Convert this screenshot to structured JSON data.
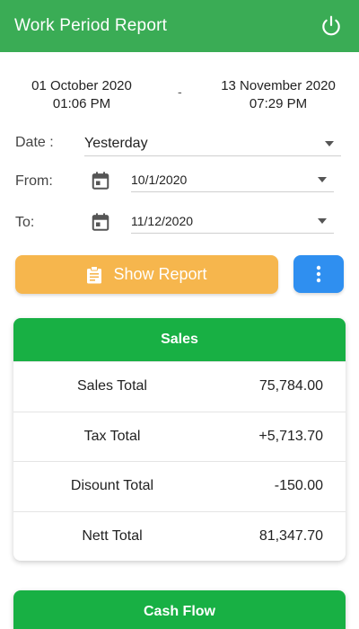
{
  "header": {
    "title": "Work Period Report",
    "power_icon": "power-icon"
  },
  "period": {
    "start_date": "01 October 2020",
    "start_time": "01:06 PM",
    "separator": "-",
    "end_date": "13 November 2020",
    "end_time": "07:29 PM"
  },
  "filters": {
    "date_label": "Date :",
    "date_value": "Yesterday",
    "from_label": "From:",
    "from_value": "10/1/2020",
    "to_label": "To:",
    "to_value": "11/12/2020"
  },
  "actions": {
    "show_report_label": "Show Report",
    "show_report_icon": "clipboard-icon",
    "more_icon": "more-vert-icon"
  },
  "sales": {
    "title": "Sales",
    "rows": [
      {
        "label": "Sales Total",
        "value": "75,784.00"
      },
      {
        "label": "Tax Total",
        "value": "+5,713.70"
      },
      {
        "label": "Disount Total",
        "value": "-150.00"
      },
      {
        "label": "Nett Total",
        "value": "81,347.70"
      }
    ]
  },
  "cash_flow": {
    "title": "Cash Flow"
  },
  "colors": {
    "appbar": "#3aac55",
    "card_header": "#18b044",
    "show_report": "#f6b64d",
    "more_button": "#2f8ff0"
  }
}
